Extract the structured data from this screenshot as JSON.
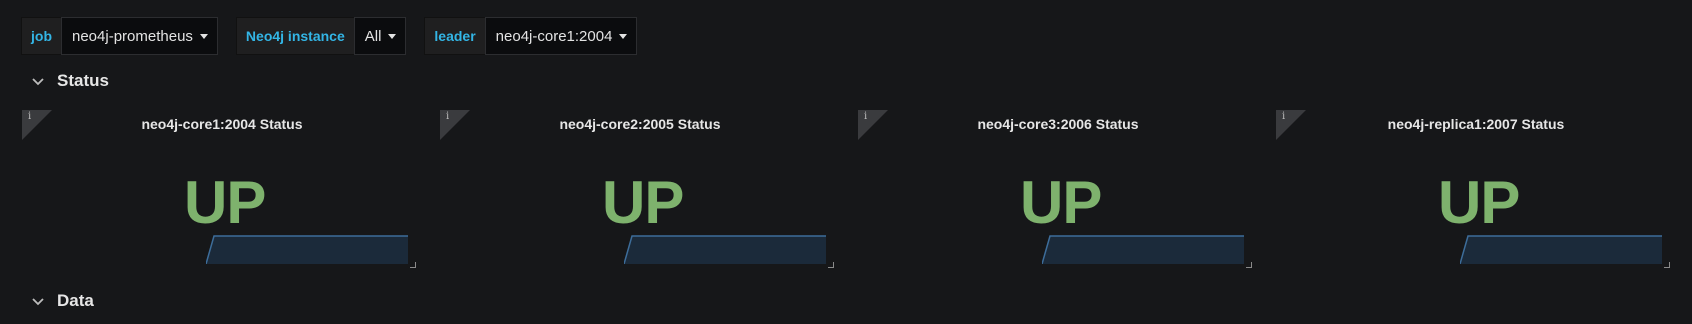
{
  "variables": [
    {
      "label": "job",
      "value": "neo4j-prometheus"
    },
    {
      "label": "Neo4j instance",
      "value": "All"
    },
    {
      "label": "leader",
      "value": "neo4j-core1:2004"
    }
  ],
  "rows": {
    "status": "Status",
    "data": "Data"
  },
  "panels": [
    {
      "title": "neo4j-core1:2004 Status",
      "value": "UP"
    },
    {
      "title": "neo4j-core2:2005 Status",
      "value": "UP"
    },
    {
      "title": "neo4j-core3:2006 Status",
      "value": "UP"
    },
    {
      "title": "neo4j-replica1:2007 Status",
      "value": "UP"
    }
  ],
  "info_symbol": "i",
  "colors": {
    "background": "#161719",
    "variable_label": "#33b5e5",
    "status_up": "#7eb26d",
    "sparkline_fill": "#1b2a3a",
    "sparkline_line": "#3d6d9a"
  },
  "icons": {
    "row_collapse": "chevron-down-icon",
    "variable_dropdown": "caret-down-icon",
    "panel_info": "info-icon",
    "panel_resize": "resize-handle-icon"
  }
}
